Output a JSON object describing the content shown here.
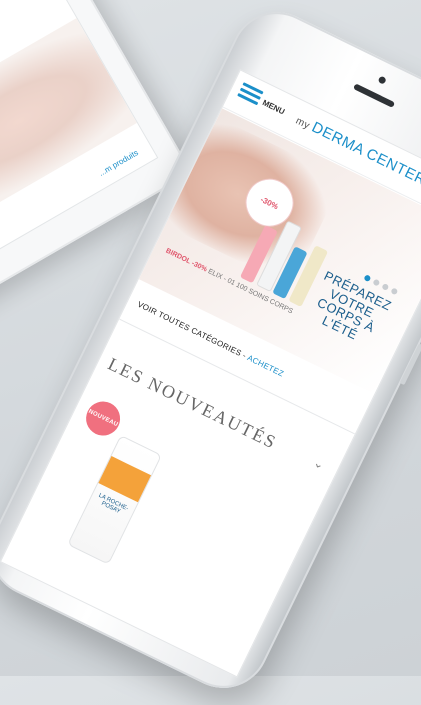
{
  "tablet": {
    "link_text": "...m produits"
  },
  "header": {
    "menu_label": "MENU",
    "logo_prefix": "my",
    "logo_name": "DERMA CENTER"
  },
  "icons": [
    "help-icon",
    "search-icon",
    "user-icon",
    "cart-icon"
  ],
  "banner": {
    "circle_text": "-30%",
    "promo_highlight": "BIRDOL -30%",
    "promo_rest": "ELIX - 01 100 SOINS CORPS",
    "headline": "PRÉPAREZ VOTRE CORPS À L'ÉTÉ",
    "dots_total": 4,
    "dots_active": 1
  },
  "categories": {
    "label": "VOIR TOUTES CATÉGORIES",
    "accent": "ACHETEZ"
  },
  "section": {
    "title": "LES NOUVEAUTÉS",
    "badge": "NOUVEAU",
    "product_label": "LA ROCHE-POSAY"
  },
  "colors": {
    "brand": "#1b8fc9",
    "accent_pink": "#f0707f"
  }
}
